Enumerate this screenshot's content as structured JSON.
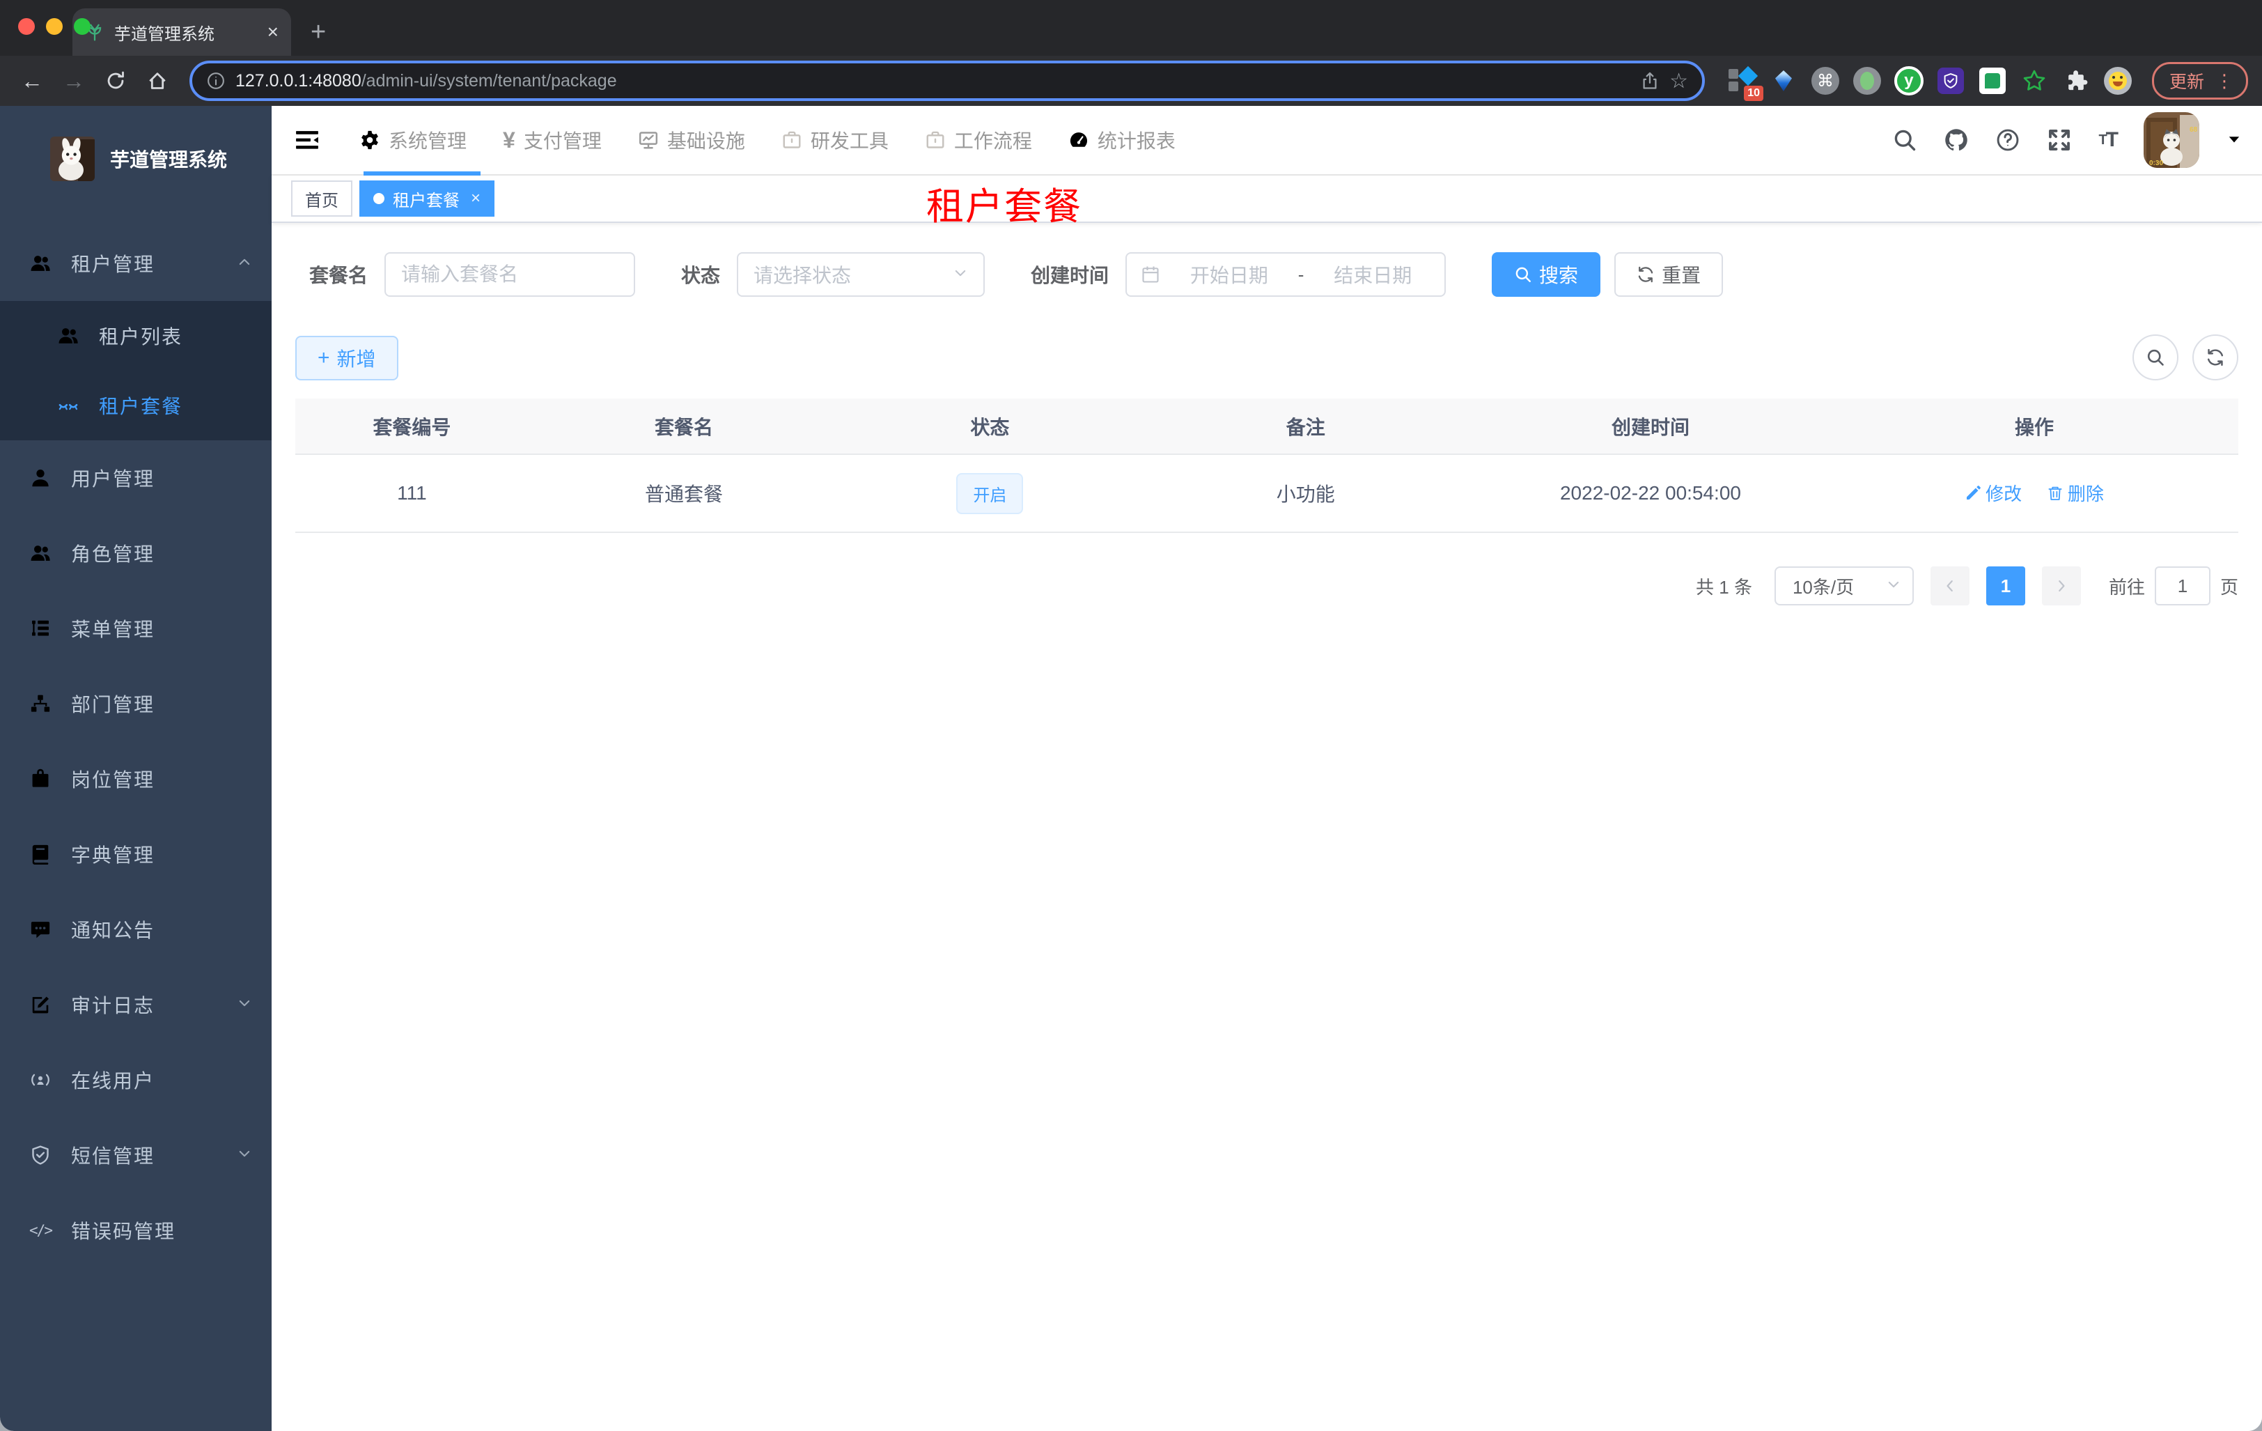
{
  "colors": {
    "accent": "#409eff",
    "sidebar_bg": "#334156",
    "title_red": "#ff0000"
  },
  "browser": {
    "tab_title": "芋道管理系统",
    "tab_close": "×",
    "new_tab": "+",
    "back": "←",
    "forward": "→",
    "url_host": "127.0.0.1:48080",
    "url_path": "/admin-ui/system/tenant/package",
    "star": "☆",
    "ext_badge": "10",
    "ext_cmd": "⌘",
    "ext_y": "y",
    "ext_star": "✩",
    "update_label": "更新",
    "menu_dots": "⋮"
  },
  "sidebar": {
    "title": "芋道管理系统",
    "items": [
      {
        "label": "租户管理",
        "icon": "peoples-icon",
        "chevron": "up"
      },
      {
        "label": "租户列表",
        "icon": "peoples-icon"
      },
      {
        "label": "租户套餐",
        "icon": "package-icon",
        "active": true
      },
      {
        "label": "用户管理",
        "icon": "user-icon"
      },
      {
        "label": "角色管理",
        "icon": "peoples-icon"
      },
      {
        "label": "菜单管理",
        "icon": "tree-table-icon"
      },
      {
        "label": "部门管理",
        "icon": "org-tree-icon"
      },
      {
        "label": "岗位管理",
        "icon": "post-icon"
      },
      {
        "label": "字典管理",
        "icon": "dict-icon"
      },
      {
        "label": "通知公告",
        "icon": "message-icon"
      },
      {
        "label": "审计日志",
        "icon": "log-icon",
        "chevron": "down"
      },
      {
        "label": "在线用户",
        "icon": "online-icon"
      },
      {
        "label": "短信管理",
        "icon": "shield-icon",
        "chevron": "down"
      },
      {
        "label": "错误码管理",
        "icon": "code-icon",
        "code_glyph": "</>"
      }
    ]
  },
  "topnav": {
    "items": [
      {
        "label": "系统管理",
        "icon": "gear-icon"
      },
      {
        "label": "支付管理",
        "icon": "yen-icon",
        "glyph": "¥"
      },
      {
        "label": "基础设施",
        "icon": "monitor-icon"
      },
      {
        "label": "研发工具",
        "icon": "briefcase-icon"
      },
      {
        "label": "工作流程",
        "icon": "suitcase-icon"
      },
      {
        "label": "统计报表",
        "icon": "dashboard-icon"
      }
    ],
    "fontsize_glyph": "T"
  },
  "tags": {
    "home": "首页",
    "active": "租户套餐",
    "close": "×"
  },
  "page_title": "租户套餐",
  "filters": {
    "name_label": "套餐名",
    "name_placeholder": "请输入套餐名",
    "status_label": "状态",
    "status_placeholder": "请选择状态",
    "time_label": "创建时间",
    "start_placeholder": "开始日期",
    "separator": "-",
    "end_placeholder": "结束日期",
    "search_label": "搜索",
    "reset_label": "重置"
  },
  "toolbar": {
    "add_label": "新增",
    "plus": "+"
  },
  "table": {
    "headers": [
      "套餐编号",
      "套餐名",
      "状态",
      "备注",
      "创建时间",
      "操作"
    ],
    "rows": [
      {
        "id": "111",
        "name": "普通套餐",
        "status": "开启",
        "remark": "小功能",
        "created": "2022-02-22 00:54:00",
        "edit_label": "修改",
        "delete_label": "删除"
      }
    ]
  },
  "pagination": {
    "total": "共 1 条",
    "page_size": "10条/页",
    "page": "1",
    "goto_label": "前往",
    "goto_value": "1",
    "unit_label": "页"
  }
}
